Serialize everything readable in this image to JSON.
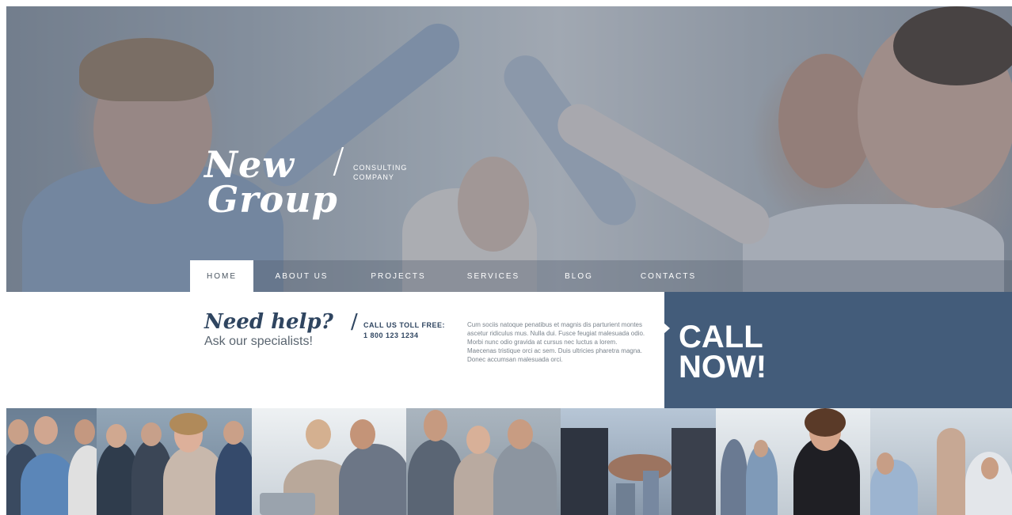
{
  "brand": {
    "name_line1": "New",
    "name_line2": "Group",
    "slash": "/",
    "tagline_line1": "CONSULTING",
    "tagline_line2": "COMPANY"
  },
  "nav": {
    "items": [
      {
        "label": "HOME",
        "active": true
      },
      {
        "label": "ABOUT US",
        "active": false
      },
      {
        "label": "PROJECTS",
        "active": false
      },
      {
        "label": "SERVICES",
        "active": false
      },
      {
        "label": "BLOG",
        "active": false
      },
      {
        "label": "CONTACTS",
        "active": false
      }
    ]
  },
  "help": {
    "heading": "Need help?",
    "slash": "/",
    "subheading": "Ask our specialists!",
    "toll_label": "CALL US TOLL FREE:",
    "toll_number": "1 800 123 1234",
    "body": "Cum sociis natoque penatibus et magnis dis parturient montes ascetur ridiculus mus. Nulla dui. Fusce feugiat malesuada odio. Morbi nunc odio gravida at cursus nec luctus a lorem. Maecenas tristique orci ac sem. Duis ultricies pharetra magna. Donec accumsan malesuada orci."
  },
  "cta": {
    "line1": "CALL",
    "line2": "NOW!"
  },
  "colors": {
    "accent": "#435c7a",
    "heading": "#2f4560",
    "nav_text": "#ffffff"
  },
  "gallery": {
    "tiles": [
      {
        "name": "team-group-photo"
      },
      {
        "name": "business-team-photo"
      },
      {
        "name": "office-meeting-photo"
      },
      {
        "name": "colleagues-photo"
      },
      {
        "name": "handshake-photo"
      },
      {
        "name": "businesswoman-photo"
      },
      {
        "name": "high-five-photo"
      }
    ]
  }
}
